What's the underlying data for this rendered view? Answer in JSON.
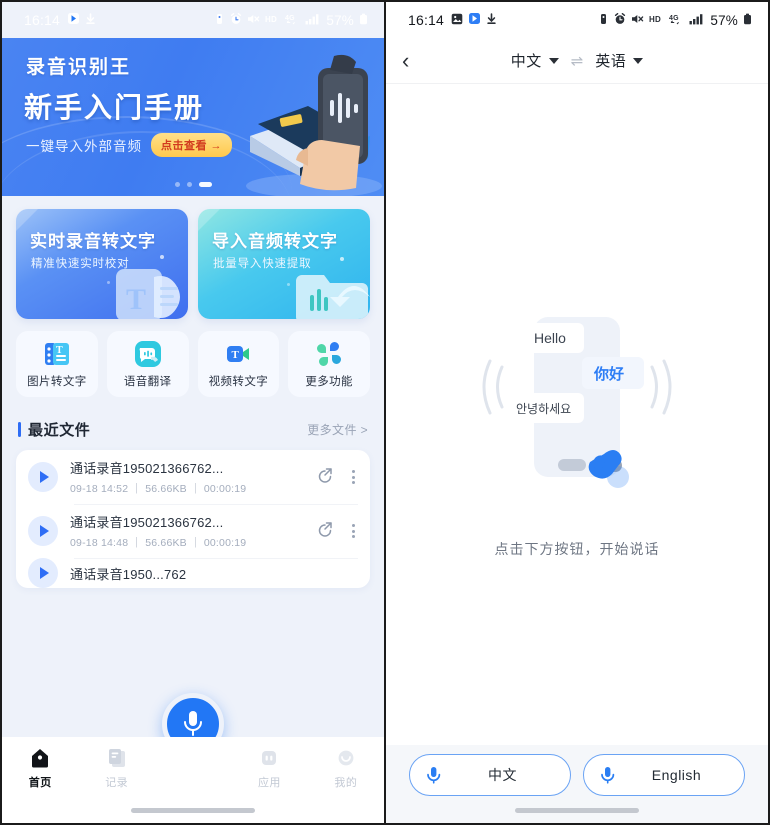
{
  "left": {
    "status": {
      "time": "16:14",
      "left_icons": [
        "app-badge-icon",
        "download-icon"
      ],
      "right_icons": [
        "vibrate-icon",
        "alarm-icon",
        "mute-icon",
        "hd-icon",
        "4g-icon",
        "signal-icon"
      ],
      "battery": "57%"
    },
    "banner": {
      "brand": "录音识别王",
      "headline": "新手入门手册",
      "subtitle": "一键导入外部音频",
      "cta": "点击查看 →",
      "dots_total": 3,
      "dots_active_index": 2
    },
    "cards": [
      {
        "title": "实时录音转文字",
        "subtitle": "精准快速实时校对",
        "accent": "#3f6fef"
      },
      {
        "title": "导入音频转文字",
        "subtitle": "批量导入快速提取",
        "accent": "#2fb3ef"
      }
    ],
    "quick_actions": [
      {
        "label": "图片转文字",
        "icon": "image-to-text-icon"
      },
      {
        "label": "语音翻译",
        "icon": "voice-translate-icon"
      },
      {
        "label": "视频转文字",
        "icon": "video-to-text-icon"
      },
      {
        "label": "更多功能",
        "icon": "more-features-icon"
      }
    ],
    "recent": {
      "title": "最近文件",
      "more": "更多文件 >",
      "files": [
        {
          "name": "通话录音195021366762...",
          "date": "09-18 14:52",
          "size": "56.66KB",
          "duration": "00:00:19"
        },
        {
          "name": "通话录音195021366762...",
          "date": "09-18 14:48",
          "size": "56.66KB",
          "duration": "00:00:19"
        },
        {
          "name": "通话录音1950...762",
          "date": "",
          "size": "",
          "duration": ""
        }
      ]
    },
    "fab": {
      "icon": "microphone-icon",
      "color": "#2277f5"
    },
    "tabs": [
      {
        "label": "首页",
        "icon": "home-icon",
        "active": true
      },
      {
        "label": "记录",
        "icon": "records-icon",
        "active": false
      },
      {
        "label": "应用",
        "icon": "apps-icon",
        "active": false
      },
      {
        "label": "我的",
        "icon": "profile-icon",
        "active": false
      }
    ]
  },
  "right": {
    "status": {
      "time": "16:14",
      "left_icons": [
        "gallery-icon",
        "app-badge-icon",
        "download-icon"
      ],
      "right_icons": [
        "vibrate-icon",
        "alarm-icon",
        "mute-icon",
        "hd-icon",
        "4g-icon",
        "signal-icon"
      ],
      "battery": "57%"
    },
    "header": {
      "back": "‹",
      "source_lang": "中文",
      "swap": "⇌",
      "target_lang": "英语"
    },
    "illustration": {
      "bubble_en": "Hello",
      "bubble_zh": "你好",
      "bubble_ko": "안녕하세요"
    },
    "hint": "点击下方按钮，开始说话",
    "mic_buttons": [
      {
        "label": "中文",
        "icon": "microphone-icon"
      },
      {
        "label": "English",
        "icon": "microphone-icon"
      }
    ]
  }
}
